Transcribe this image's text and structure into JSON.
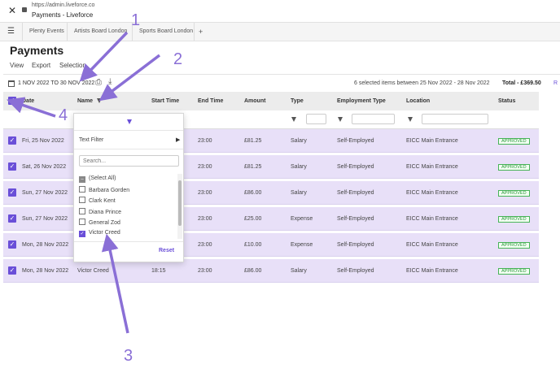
{
  "browser": {
    "url": "https://admin.liveforce.co",
    "page_title": "Payments - Liveforce",
    "tabs": [
      "Plenty Events",
      "Artists Board London",
      "Sports Board London"
    ],
    "new_tab": "+"
  },
  "page": {
    "heading": "Payments",
    "menu": [
      "View",
      "Export",
      "Selection"
    ],
    "date_range": "1 NOV 2022 TO 30 NOV 2022",
    "summary": "6 selected items between 25 Nov 2022 - 28 Nov 2022",
    "total": "Total - £369.50",
    "edge_letter": "R"
  },
  "columns": [
    "Date",
    "Name",
    "Start Time",
    "End Time",
    "Amount",
    "Type",
    "Employment Type",
    "Location",
    "Status"
  ],
  "rows": [
    {
      "date": "Fri, 25 Nov 2022",
      "name": "",
      "start": "",
      "end": "23:00",
      "amount": "£81.25",
      "type": "Salary",
      "emp": "Self-Employed",
      "loc": "EICC Main Entrance",
      "status": "APPROVED"
    },
    {
      "date": "Sat, 26 Nov 2022",
      "name": "",
      "start": "",
      "end": "23:00",
      "amount": "£81.25",
      "type": "Salary",
      "emp": "Self-Employed",
      "loc": "EICC Main Entrance",
      "status": "APPROVED"
    },
    {
      "date": "Sun, 27 Nov 2022",
      "name": "",
      "start": "",
      "end": "23:00",
      "amount": "£86.00",
      "type": "Salary",
      "emp": "Self-Employed",
      "loc": "EICC Main Entrance",
      "status": "APPROVED"
    },
    {
      "date": "Sun, 27 Nov 2022",
      "name": "",
      "start": "",
      "end": "23:00",
      "amount": "£25.00",
      "type": "Expense",
      "emp": "Self-Employed",
      "loc": "EICC Main Entrance",
      "status": "APPROVED"
    },
    {
      "date": "Mon, 28 Nov 2022",
      "name": "",
      "start": "",
      "end": "23:00",
      "amount": "£10.00",
      "type": "Expense",
      "emp": "Self-Employed",
      "loc": "EICC Main Entrance",
      "status": "APPROVED"
    },
    {
      "date": "Mon, 28 Nov 2022",
      "name": "Victor Creed",
      "start": "18:15",
      "end": "23:00",
      "amount": "£86.00",
      "type": "Salary",
      "emp": "Self-Employed",
      "loc": "EICC Main Entrance",
      "status": "APPROVED"
    }
  ],
  "filter_popup": {
    "text_filter": "Text Filter",
    "search_placeholder": "Search...",
    "options": [
      {
        "label": "(Select All)",
        "state": "partial"
      },
      {
        "label": "Barbara Gorden",
        "state": "unchecked"
      },
      {
        "label": "Clark Kent",
        "state": "unchecked"
      },
      {
        "label": "Diana Prince",
        "state": "unchecked"
      },
      {
        "label": "General Zod",
        "state": "unchecked"
      },
      {
        "label": "Victor Creed",
        "state": "checked"
      }
    ],
    "reset": "Reset"
  },
  "annotations": [
    "1",
    "2",
    "3",
    "4"
  ],
  "colors": {
    "accent": "#6a4fd8",
    "row_selected": "#e8e0f8",
    "approved": "#2a9a3a",
    "arrow": "#8a6fd6"
  }
}
